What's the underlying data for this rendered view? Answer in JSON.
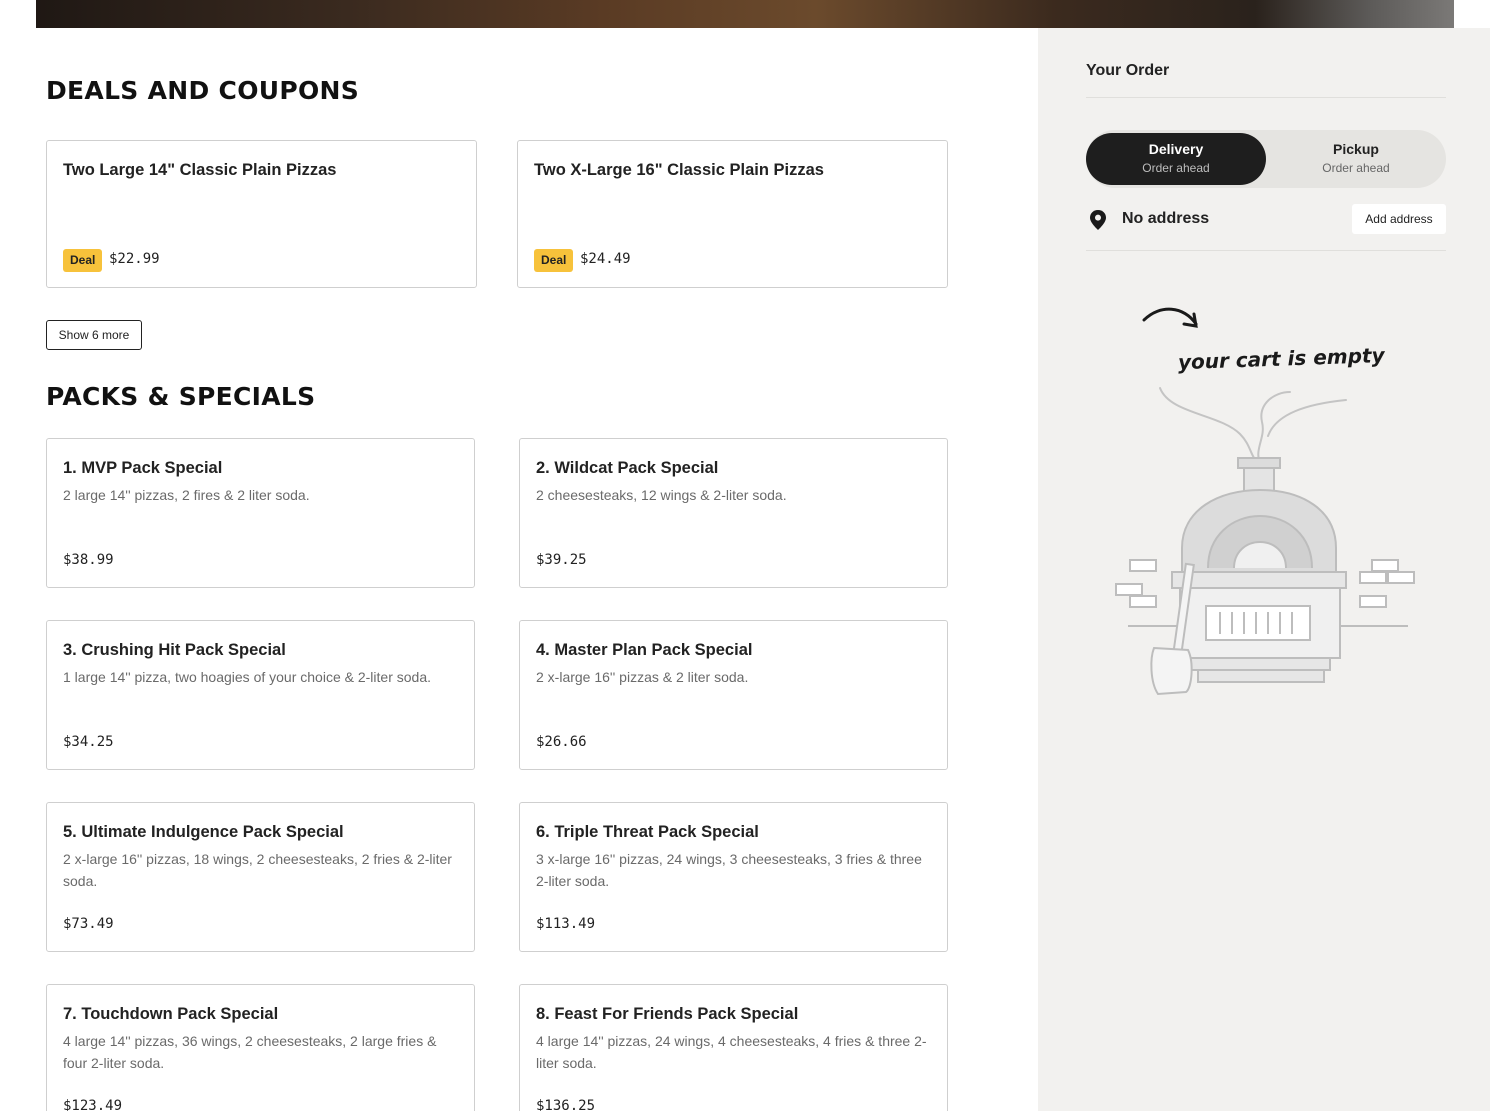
{
  "deals": {
    "title": "DEALS AND COUPONS",
    "items": [
      {
        "name": "Two Large 14\" Classic Plain Pizzas",
        "badge": "Deal",
        "price": "$22.99"
      },
      {
        "name": "Two X-Large 16\" Classic Plain Pizzas",
        "badge": "Deal",
        "price": "$24.49"
      }
    ],
    "show_more_label": "Show 6 more"
  },
  "packs": {
    "title": "PACKS & SPECIALS",
    "items": [
      {
        "name": "1. MVP Pack Special",
        "desc": "2 large 14'' pizzas, 2 fires & 2 liter soda.",
        "price": "$38.99"
      },
      {
        "name": "2. Wildcat Pack Special",
        "desc": "2 cheesesteaks, 12 wings & 2-liter soda.",
        "price": "$39.25"
      },
      {
        "name": "3. Crushing Hit Pack Special",
        "desc": "1 large 14'' pizza, two hoagies of your choice & 2-liter soda.",
        "price": "$34.25"
      },
      {
        "name": "4. Master Plan Pack Special",
        "desc": "2 x-large 16'' pizzas & 2 liter soda.",
        "price": "$26.66"
      },
      {
        "name": "5. Ultimate Indulgence Pack Special",
        "desc": "2 x-large 16'' pizzas, 18 wings, 2 cheesesteaks, 2 fries & 2-liter soda.",
        "price": "$73.49"
      },
      {
        "name": "6. Triple Threat Pack Special",
        "desc": "3 x-large 16'' pizzas, 24 wings, 3 cheesesteaks, 3 fries & three 2-liter soda.",
        "price": "$113.49"
      },
      {
        "name": "7. Touchdown Pack Special",
        "desc": "4 large 14'' pizzas, 36 wings, 2 cheesesteaks, 2 large fries & four 2-liter soda.",
        "price": "$123.49"
      },
      {
        "name": "8. Feast For Friends Pack Special",
        "desc": "4 large 14'' pizzas, 24 wings, 4 cheesesteaks, 4 fries & three 2-liter soda.",
        "price": "$136.25"
      }
    ]
  },
  "order": {
    "title": "Your Order",
    "delivery": {
      "label": "Delivery",
      "sub": "Order ahead"
    },
    "pickup": {
      "label": "Pickup",
      "sub": "Order ahead"
    },
    "address": {
      "icon": "location-pin-icon",
      "text": "No address",
      "button": "Add address"
    },
    "empty_text": "your cart is empty"
  },
  "colors": {
    "badge": "#f7c23b",
    "sidebar_bg": "#f2f1ef",
    "active_toggle": "#1e1e1e"
  }
}
